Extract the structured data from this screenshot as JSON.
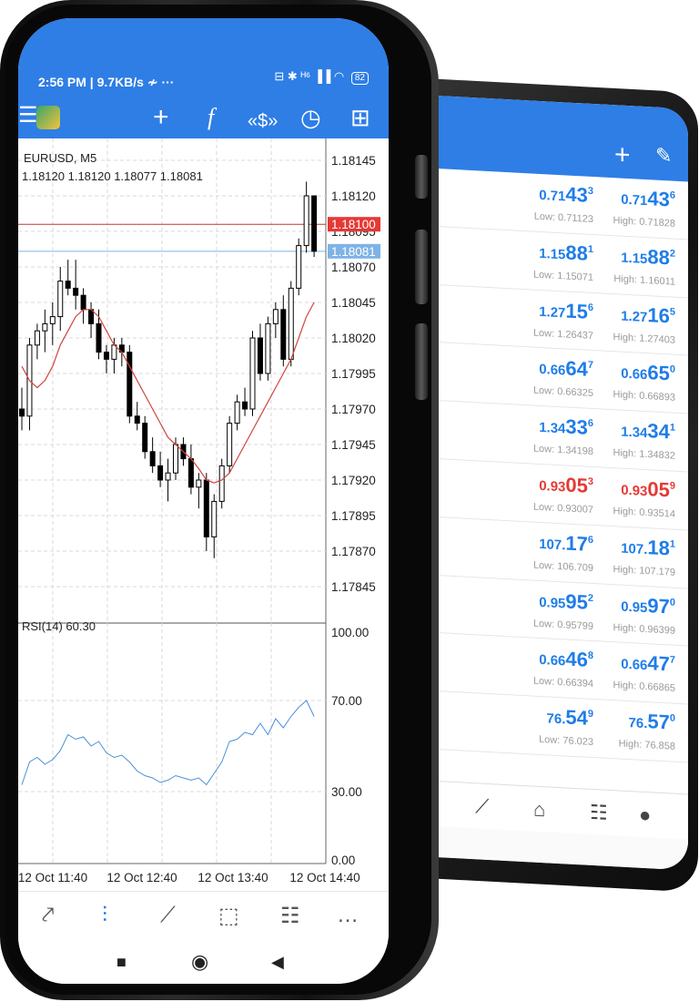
{
  "back_screen": {
    "quotes": [
      {
        "bid_big": "0.71",
        "bid_pips": "43",
        "bid_point": "3",
        "bid_red": false,
        "ask_big": "0.71",
        "ask_pips": "43",
        "ask_point": "6",
        "ask_red": false,
        "low": "Low: 0.71123",
        "high": "High: 0.71828"
      },
      {
        "bid_big": "1.15",
        "bid_pips": "88",
        "bid_point": "1",
        "bid_red": false,
        "ask_big": "1.15",
        "ask_pips": "88",
        "ask_point": "2",
        "ask_red": false,
        "low": "Low: 1.15071",
        "high": "High: 1.16011"
      },
      {
        "bid_big": "1.27",
        "bid_pips": "15",
        "bid_point": "6",
        "bid_red": false,
        "ask_big": "1.27",
        "ask_pips": "16",
        "ask_point": "5",
        "ask_red": false,
        "low": "Low: 1.26437",
        "high": "High: 1.27403"
      },
      {
        "bid_big": "0.66",
        "bid_pips": "64",
        "bid_point": "7",
        "bid_red": false,
        "ask_big": "0.66",
        "ask_pips": "65",
        "ask_point": "0",
        "ask_red": false,
        "low": "Low: 0.66325",
        "high": "High: 0.66893"
      },
      {
        "bid_big": "1.34",
        "bid_pips": "33",
        "bid_point": "6",
        "bid_red": false,
        "ask_big": "1.34",
        "ask_pips": "34",
        "ask_point": "1",
        "ask_red": false,
        "low": "Low: 1.34198",
        "high": "High: 1.34832"
      },
      {
        "bid_big": "0.93",
        "bid_pips": "05",
        "bid_point": "3",
        "bid_red": true,
        "ask_big": "0.93",
        "ask_pips": "05",
        "ask_point": "9",
        "ask_red": true,
        "low": "Low: 0.93007",
        "high": "High: 0.93514"
      },
      {
        "bid_big": "107.",
        "bid_pips": "17",
        "bid_point": "6",
        "bid_red": false,
        "ask_big": "107.",
        "ask_pips": "18",
        "ask_point": "1",
        "ask_red": false,
        "low": "Low: 106.709",
        "high": "High: 107.179"
      },
      {
        "bid_big": "0.95",
        "bid_pips": "95",
        "bid_point": "2",
        "bid_red": false,
        "ask_big": "0.95",
        "ask_pips": "97",
        "ask_point": "0",
        "ask_red": false,
        "low": "Low: 0.95799",
        "high": "High: 0.96399"
      },
      {
        "bid_big": "0.66",
        "bid_pips": "46",
        "bid_point": "8",
        "bid_red": false,
        "ask_big": "0.66",
        "ask_pips": "47",
        "ask_point": "7",
        "ask_red": false,
        "low": "Low: 0.66394",
        "high": "High: 0.66865"
      },
      {
        "bid_big": "76.",
        "bid_pips": "54",
        "bid_point": "9",
        "bid_red": false,
        "ask_big": "76.",
        "ask_pips": "57",
        "ask_point": "0",
        "ask_red": false,
        "low": "Low: 76.023",
        "high": "High: 76.858"
      }
    ],
    "toolbar": {
      "add_icon": "plus-icon",
      "edit_icon": "pencil-icon"
    }
  },
  "front_screen": {
    "status": {
      "time": "2:56 PM | 9.7KB/s ≁ ···",
      "indicators": "⊟ ✱ ᴴ⁶ ▐▐ ◠",
      "battery": "82"
    },
    "toolbar": {
      "menu_icon": "☰",
      "crosshair_icon": "+",
      "function_icon": "f",
      "trade_icon": "«$»",
      "timeframe_icon": "◷",
      "add_doc_icon": "⊞"
    },
    "chart": {
      "symbol": "EURUSD, M5",
      "ohlc": "1.18120 1.18120 1.18077 1.18081",
      "rsi_label": "RSI(14) 60.30"
    },
    "nav": [
      "⤤",
      "⫶",
      "⟋",
      "⬚",
      "☷",
      "…"
    ]
  },
  "chart_data": {
    "type": "candlestick",
    "title": "EURUSD, M5",
    "ylim": [
      1.1783,
      1.1816
    ],
    "yticks": [
      "1.18145",
      "1.18120",
      "1.18095",
      "1.18070",
      "1.18045",
      "1.18020",
      "1.17995",
      "1.17970",
      "1.17945",
      "1.17920",
      "1.17895",
      "1.17870",
      "1.17845"
    ],
    "xticks": [
      "12 Oct 11:40",
      "12 Oct 12:40",
      "12 Oct 13:40",
      "12 Oct 14:40"
    ],
    "bid_line": "1.18100",
    "ask_line": "1.18081",
    "candles": [
      [
        1.1797,
        1.17985,
        1.17955,
        1.17965
      ],
      [
        1.17965,
        1.1802,
        1.17955,
        1.18015
      ],
      [
        1.18015,
        1.1803,
        1.18005,
        1.18025
      ],
      [
        1.18025,
        1.1804,
        1.1801,
        1.1803
      ],
      [
        1.1803,
        1.18045,
        1.18015,
        1.18035
      ],
      [
        1.18035,
        1.1807,
        1.18025,
        1.1806
      ],
      [
        1.1806,
        1.18075,
        1.1805,
        1.18055
      ],
      [
        1.18055,
        1.18075,
        1.1804,
        1.1805
      ],
      [
        1.1805,
        1.18055,
        1.1803,
        1.1804
      ],
      [
        1.1804,
        1.18045,
        1.1802,
        1.1803
      ],
      [
        1.1803,
        1.1804,
        1.18005,
        1.1801
      ],
      [
        1.1801,
        1.18015,
        1.17995,
        1.18005
      ],
      [
        1.18005,
        1.1802,
        1.17995,
        1.18015
      ],
      [
        1.18015,
        1.1802,
        1.18,
        1.1801
      ],
      [
        1.1801,
        1.18015,
        1.1796,
        1.17965
      ],
      [
        1.17965,
        1.17975,
        1.17955,
        1.1796
      ],
      [
        1.1796,
        1.17965,
        1.17935,
        1.1794
      ],
      [
        1.1794,
        1.1795,
        1.17925,
        1.1793
      ],
      [
        1.1793,
        1.1794,
        1.17915,
        1.1792
      ],
      [
        1.1792,
        1.17935,
        1.17905,
        1.17925
      ],
      [
        1.17925,
        1.1795,
        1.1792,
        1.17945
      ],
      [
        1.17945,
        1.1795,
        1.1793,
        1.17935
      ],
      [
        1.17935,
        1.17945,
        1.1791,
        1.17915
      ],
      [
        1.17915,
        1.17925,
        1.179,
        1.1792
      ],
      [
        1.1792,
        1.17925,
        1.1787,
        1.1788
      ],
      [
        1.1788,
        1.1791,
        1.17865,
        1.17905
      ],
      [
        1.17905,
        1.17935,
        1.179,
        1.1793
      ],
      [
        1.1793,
        1.17965,
        1.17925,
        1.1796
      ],
      [
        1.1796,
        1.1798,
        1.17955,
        1.17975
      ],
      [
        1.17975,
        1.17985,
        1.17965,
        1.1797
      ],
      [
        1.1797,
        1.18025,
        1.17965,
        1.1802
      ],
      [
        1.1802,
        1.1803,
        1.1799,
        1.17995
      ],
      [
        1.17995,
        1.18035,
        1.1799,
        1.1803
      ],
      [
        1.1803,
        1.18045,
        1.1802,
        1.1804
      ],
      [
        1.1804,
        1.1805,
        1.18,
        1.18005
      ],
      [
        1.18005,
        1.1806,
        1.18,
        1.18055
      ],
      [
        1.18055,
        1.1809,
        1.1805,
        1.18085
      ],
      [
        1.18085,
        1.1813,
        1.1808,
        1.1812
      ],
      [
        1.1812,
        1.1812,
        1.18077,
        1.18081
      ]
    ],
    "ma": [
      1.18,
      1.1799,
      1.17985,
      1.1799,
      1.18,
      1.18015,
      1.18025,
      1.18035,
      1.1804,
      1.1804,
      1.18035,
      1.18025,
      1.18015,
      1.1801,
      1.18,
      1.1799,
      1.1798,
      1.1797,
      1.1796,
      1.1795,
      1.17945,
      1.1794,
      1.17935,
      1.17928,
      1.1792,
      1.17918,
      1.1792,
      1.17925,
      1.17935,
      1.17945,
      1.17955,
      1.17965,
      1.17975,
      1.17985,
      1.17995,
      1.18005,
      1.1802,
      1.18035,
      1.18045
    ],
    "rsi": {
      "label": "RSI(14) 60.30",
      "ylim": [
        0,
        100
      ],
      "yticks": [
        "100.00",
        "70.00",
        "30.00",
        "0.00"
      ],
      "values": [
        33,
        43,
        45,
        42,
        44,
        48,
        55,
        53,
        54,
        50,
        52,
        47,
        45,
        46,
        43,
        39,
        37,
        36,
        34,
        35,
        37,
        36,
        35,
        36,
        33,
        38,
        43,
        52,
        53,
        56,
        55,
        60,
        55,
        62,
        58,
        63,
        67,
        70,
        63
      ]
    }
  }
}
